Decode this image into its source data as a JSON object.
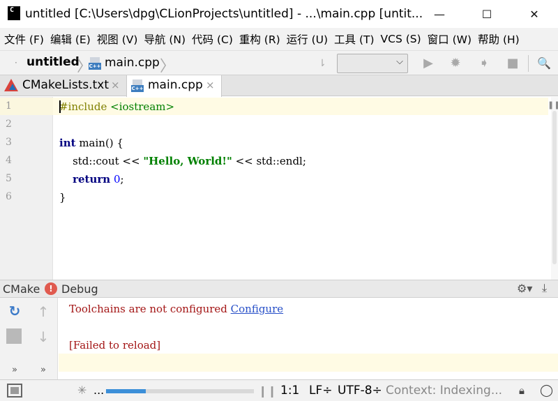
{
  "window": {
    "title": "untitled [C:\\Users\\dpg\\CLionProjects\\untitled] - ...\\main.cpp [untit...",
    "app_icon_glyph": "C",
    "min_glyph": "—",
    "max_glyph": "☐",
    "close_glyph": "✕"
  },
  "menu": {
    "items": [
      "文件 (F)",
      "编辑 (E)",
      "视图 (V)",
      "导航 (N)",
      "代码 (C)",
      "重构 (R)",
      "运行 (U)",
      "工具 (T)",
      "VCS (S)",
      "窗口 (W)",
      "帮助 (H)"
    ]
  },
  "navbar": {
    "project": "untitled",
    "file": "main.cpp",
    "cpp_badge": "C++",
    "separator": "〉",
    "config_value": "",
    "icons": {
      "binary": "⇂",
      "run": "▶",
      "debug": "✹",
      "profile": "➧",
      "stop": "■",
      "search": "🔍"
    }
  },
  "tabs": [
    {
      "label": "CMakeLists.txt",
      "close": "×"
    },
    {
      "label": "main.cpp",
      "close": "×",
      "badge": "C++"
    }
  ],
  "editor": {
    "line_numbers": [
      "1",
      "2",
      "3",
      "4",
      "5",
      "6"
    ],
    "lines": {
      "l1_pre": "#include",
      "l1_inc": " <iostream>",
      "l3_kw": "int",
      "l3_rest": " main() {",
      "l4_a": "    std::cout << ",
      "l4_str": "\"Hello, World!\"",
      "l4_b": " << std::endl;",
      "l5_indent": "    ",
      "l5_kw": "return",
      "l5_sp": " ",
      "l5_num": "0",
      "l5_end": ";",
      "l6": "}"
    },
    "pause_glyph": "❚❚"
  },
  "cmake": {
    "title": "CMake",
    "error_glyph": "!",
    "profile": "Debug",
    "gear_glyph": "⚙▾",
    "hide_glyph": "⤓",
    "side": {
      "reload": "↻",
      "up": "↑",
      "down": "↓",
      "more1": "»",
      "more2": "»"
    },
    "output": {
      "line1_text": "Toolchains are not configured ",
      "line1_link": "Configure",
      "line2": "[Failed to reload]"
    }
  },
  "status": {
    "spinner": "✳",
    "dots": "...",
    "progress_fraction": 0.27,
    "pause": "❙❙",
    "position": "1:1",
    "line_sep": "LF÷",
    "encoding": "UTF-8÷",
    "context": "Context: Indexing...",
    "lock": "🔒︎",
    "chat": "◯"
  },
  "colors": {
    "progress": "#3c8fd8",
    "error": "#e05a4f",
    "link": "#2850c8"
  }
}
